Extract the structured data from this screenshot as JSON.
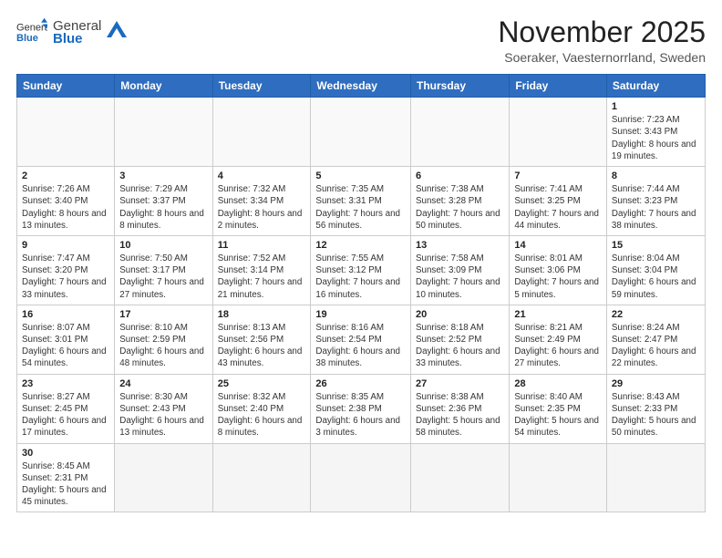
{
  "logo": {
    "text_general": "General",
    "text_blue": "Blue"
  },
  "title": "November 2025",
  "subtitle": "Soeraker, Vaesternorrland, Sweden",
  "weekdays": [
    "Sunday",
    "Monday",
    "Tuesday",
    "Wednesday",
    "Thursday",
    "Friday",
    "Saturday"
  ],
  "weeks": [
    [
      {
        "day": null
      },
      {
        "day": null
      },
      {
        "day": null
      },
      {
        "day": null
      },
      {
        "day": null
      },
      {
        "day": null
      },
      {
        "day": 1,
        "sunrise": "7:23 AM",
        "sunset": "3:43 PM",
        "daylight": "8 hours and 19 minutes."
      }
    ],
    [
      {
        "day": 2,
        "sunrise": "7:26 AM",
        "sunset": "3:40 PM",
        "daylight": "8 hours and 13 minutes."
      },
      {
        "day": 3,
        "sunrise": "7:29 AM",
        "sunset": "3:37 PM",
        "daylight": "8 hours and 8 minutes."
      },
      {
        "day": 4,
        "sunrise": "7:32 AM",
        "sunset": "3:34 PM",
        "daylight": "8 hours and 2 minutes."
      },
      {
        "day": 5,
        "sunrise": "7:35 AM",
        "sunset": "3:31 PM",
        "daylight": "7 hours and 56 minutes."
      },
      {
        "day": 6,
        "sunrise": "7:38 AM",
        "sunset": "3:28 PM",
        "daylight": "7 hours and 50 minutes."
      },
      {
        "day": 7,
        "sunrise": "7:41 AM",
        "sunset": "3:25 PM",
        "daylight": "7 hours and 44 minutes."
      },
      {
        "day": 8,
        "sunrise": "7:44 AM",
        "sunset": "3:23 PM",
        "daylight": "7 hours and 38 minutes."
      }
    ],
    [
      {
        "day": 9,
        "sunrise": "7:47 AM",
        "sunset": "3:20 PM",
        "daylight": "7 hours and 33 minutes."
      },
      {
        "day": 10,
        "sunrise": "7:50 AM",
        "sunset": "3:17 PM",
        "daylight": "7 hours and 27 minutes."
      },
      {
        "day": 11,
        "sunrise": "7:52 AM",
        "sunset": "3:14 PM",
        "daylight": "7 hours and 21 minutes."
      },
      {
        "day": 12,
        "sunrise": "7:55 AM",
        "sunset": "3:12 PM",
        "daylight": "7 hours and 16 minutes."
      },
      {
        "day": 13,
        "sunrise": "7:58 AM",
        "sunset": "3:09 PM",
        "daylight": "7 hours and 10 minutes."
      },
      {
        "day": 14,
        "sunrise": "8:01 AM",
        "sunset": "3:06 PM",
        "daylight": "7 hours and 5 minutes."
      },
      {
        "day": 15,
        "sunrise": "8:04 AM",
        "sunset": "3:04 PM",
        "daylight": "6 hours and 59 minutes."
      }
    ],
    [
      {
        "day": 16,
        "sunrise": "8:07 AM",
        "sunset": "3:01 PM",
        "daylight": "6 hours and 54 minutes."
      },
      {
        "day": 17,
        "sunrise": "8:10 AM",
        "sunset": "2:59 PM",
        "daylight": "6 hours and 48 minutes."
      },
      {
        "day": 18,
        "sunrise": "8:13 AM",
        "sunset": "2:56 PM",
        "daylight": "6 hours and 43 minutes."
      },
      {
        "day": 19,
        "sunrise": "8:16 AM",
        "sunset": "2:54 PM",
        "daylight": "6 hours and 38 minutes."
      },
      {
        "day": 20,
        "sunrise": "8:18 AM",
        "sunset": "2:52 PM",
        "daylight": "6 hours and 33 minutes."
      },
      {
        "day": 21,
        "sunrise": "8:21 AM",
        "sunset": "2:49 PM",
        "daylight": "6 hours and 27 minutes."
      },
      {
        "day": 22,
        "sunrise": "8:24 AM",
        "sunset": "2:47 PM",
        "daylight": "6 hours and 22 minutes."
      }
    ],
    [
      {
        "day": 23,
        "sunrise": "8:27 AM",
        "sunset": "2:45 PM",
        "daylight": "6 hours and 17 minutes."
      },
      {
        "day": 24,
        "sunrise": "8:30 AM",
        "sunset": "2:43 PM",
        "daylight": "6 hours and 13 minutes."
      },
      {
        "day": 25,
        "sunrise": "8:32 AM",
        "sunset": "2:40 PM",
        "daylight": "6 hours and 8 minutes."
      },
      {
        "day": 26,
        "sunrise": "8:35 AM",
        "sunset": "2:38 PM",
        "daylight": "6 hours and 3 minutes."
      },
      {
        "day": 27,
        "sunrise": "8:38 AM",
        "sunset": "2:36 PM",
        "daylight": "5 hours and 58 minutes."
      },
      {
        "day": 28,
        "sunrise": "8:40 AM",
        "sunset": "2:35 PM",
        "daylight": "5 hours and 54 minutes."
      },
      {
        "day": 29,
        "sunrise": "8:43 AM",
        "sunset": "2:33 PM",
        "daylight": "5 hours and 50 minutes."
      }
    ],
    [
      {
        "day": 30,
        "sunrise": "8:45 AM",
        "sunset": "2:31 PM",
        "daylight": "5 hours and 45 minutes."
      },
      {
        "day": null
      },
      {
        "day": null
      },
      {
        "day": null
      },
      {
        "day": null
      },
      {
        "day": null
      },
      {
        "day": null
      }
    ]
  ]
}
